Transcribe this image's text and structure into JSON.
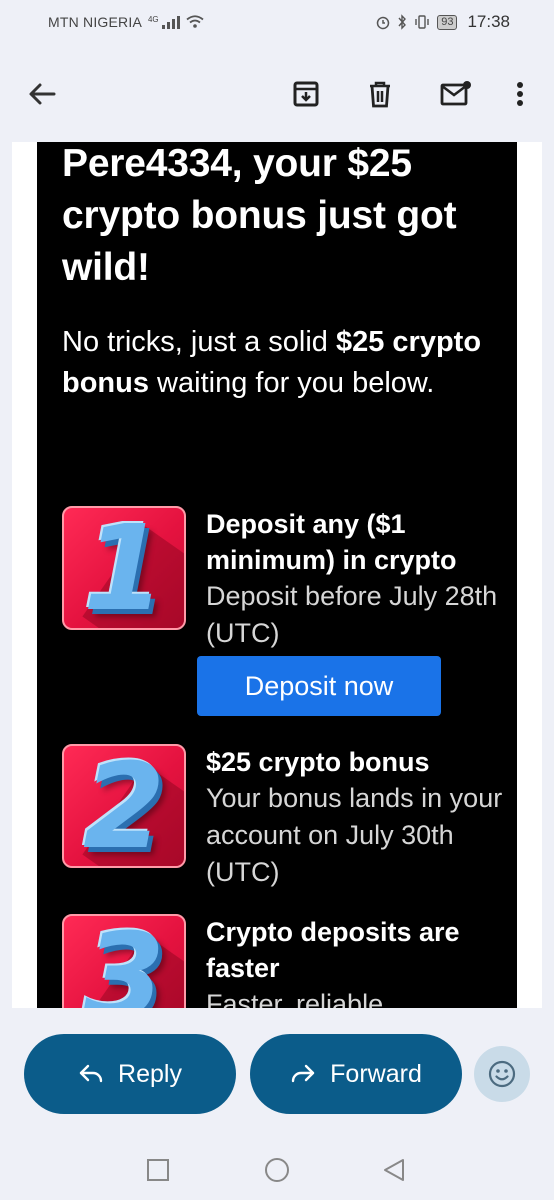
{
  "status_bar": {
    "carrier": "MTN NIGERIA",
    "network": "4G",
    "battery": "93",
    "time": "17:38"
  },
  "toolbar": {
    "icons": [
      "back-arrow-icon",
      "archive-icon",
      "delete-icon",
      "mark-unread-icon",
      "more-vert-icon"
    ]
  },
  "email": {
    "headline": "Pere4334, your $25 crypto bonus just got wild!",
    "intro_prefix": "No tricks, just a solid ",
    "intro_bold": "$25 crypto bonus",
    "intro_suffix": " waiting for you below.",
    "steps": [
      {
        "number": "1",
        "title": "Deposit any ($1 minimum) in crypto",
        "description": "Deposit before July 28th (UTC)"
      },
      {
        "number": "2",
        "title": "$25 crypto bonus",
        "description": "Your bonus lands in your account on July 30th (UTC)"
      },
      {
        "number": "3",
        "title": "Crypto deposits are faster",
        "description": "Faster, reliable,"
      }
    ],
    "cta_label": "Deposit now"
  },
  "actions": {
    "reply_label": "Reply",
    "forward_label": "Forward"
  },
  "colors": {
    "accent_blue": "#1a73e8",
    "pill_blue": "#0b5c8a",
    "badge_red": "#e4123f",
    "email_bg": "#000000",
    "page_bg": "#eef0f7"
  }
}
